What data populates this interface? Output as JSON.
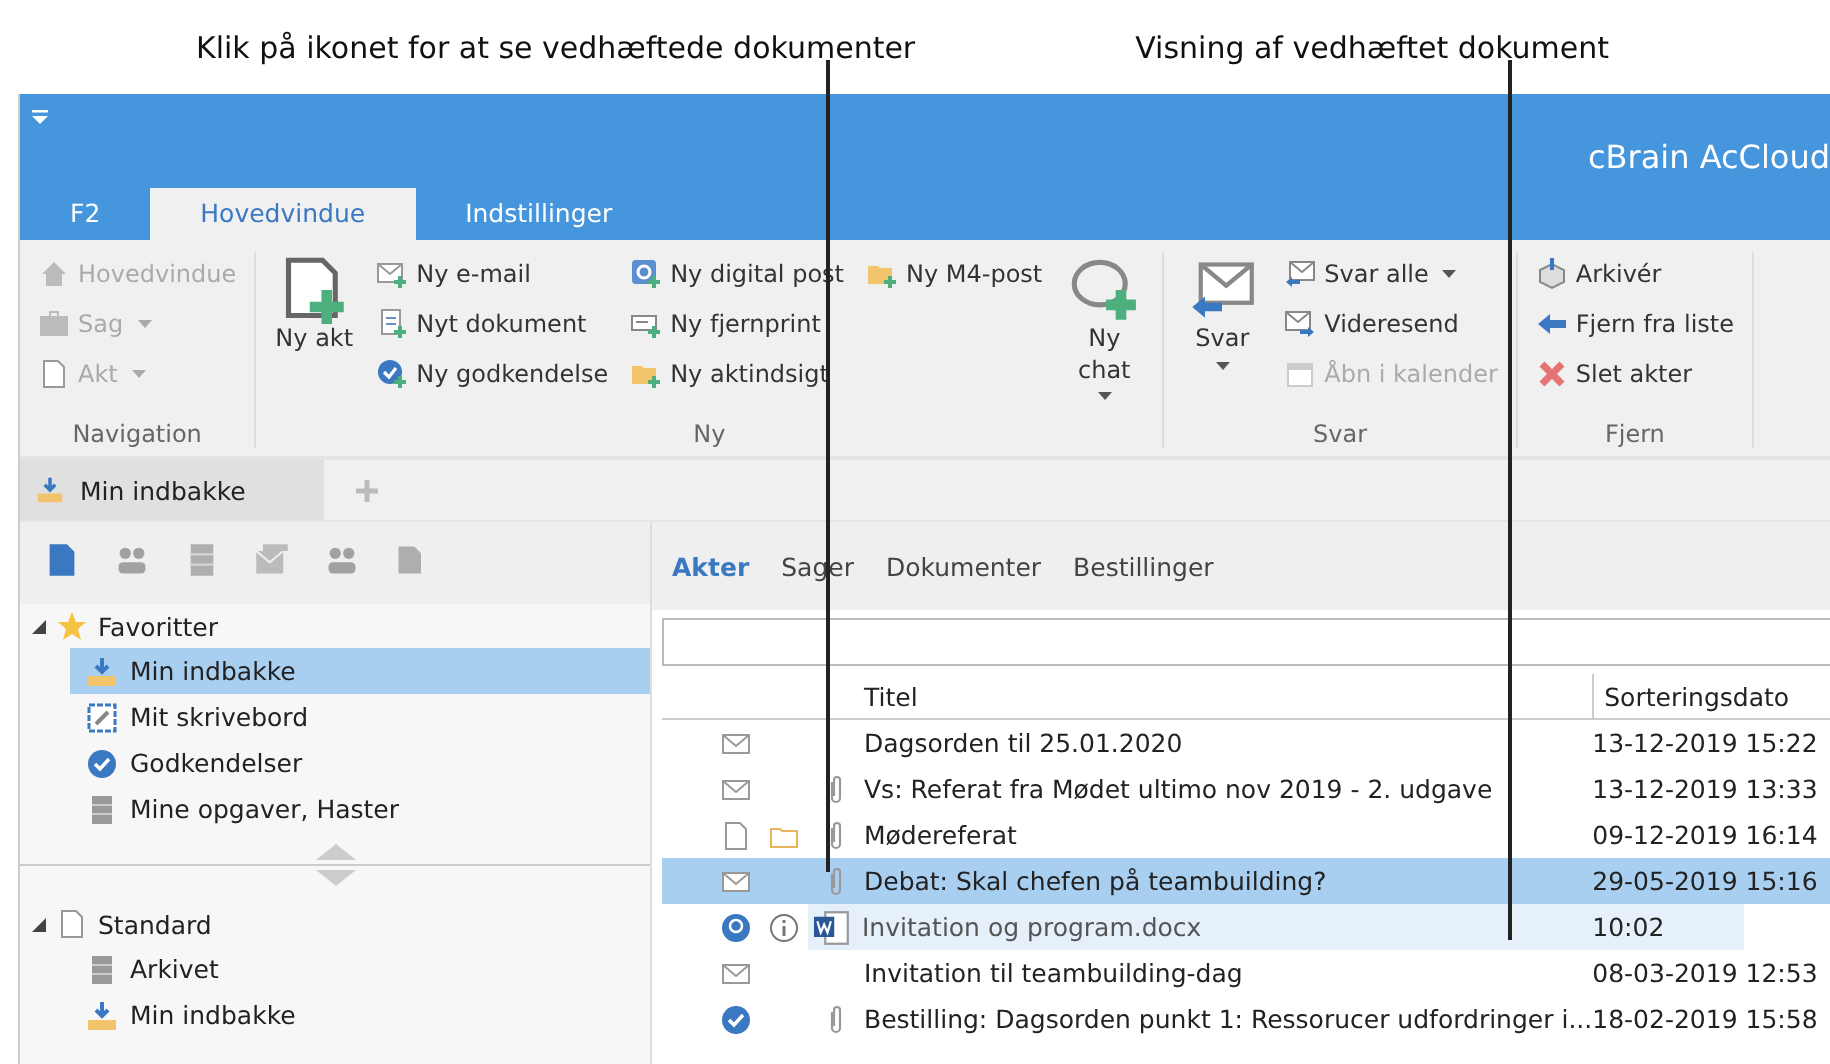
{
  "callouts": [
    {
      "text": "Klik på ikonet for at se vedhæftede dokumenter"
    },
    {
      "text": "Visning af vedhæftet dokument"
    }
  ],
  "window": {
    "title": "cBrain AcCloud"
  },
  "ribbon_tabs": [
    {
      "label": "F2",
      "selected": false
    },
    {
      "label": "Hovedvindue",
      "selected": true
    },
    {
      "label": "Indstillinger",
      "selected": false
    }
  ],
  "ribbon_groups": [
    {
      "label": "Navigation",
      "columns": [
        {
          "kind": "stack",
          "items": [
            {
              "kind": "house",
              "label": "Hovedvindue",
              "disabled": true,
              "dropdown": false
            },
            {
              "kind": "briefcase",
              "label": "Sag",
              "disabled": true,
              "dropdown": true
            },
            {
              "kind": "page",
              "label": "Akt",
              "disabled": true,
              "dropdown": true
            }
          ]
        }
      ]
    },
    {
      "label": "Ny",
      "columns": [
        {
          "kind": "large",
          "items": [
            {
              "kind": "page-plus",
              "label": "Ny akt",
              "disabled": false,
              "dropdown": false
            }
          ]
        },
        {
          "kind": "stack",
          "items": [
            {
              "kind": "envelope-plus",
              "label": "Ny e-mail",
              "disabled": false,
              "dropdown": false
            },
            {
              "kind": "document-plus",
              "label": "Nyt dokument",
              "disabled": false,
              "dropdown": false
            },
            {
              "kind": "check-plus",
              "label": "Ny godkendelse",
              "disabled": false,
              "dropdown": false
            }
          ]
        },
        {
          "kind": "stack",
          "items": [
            {
              "kind": "target-plus",
              "label": "Ny digital post",
              "disabled": false,
              "dropdown": false
            },
            {
              "kind": "printer-plus",
              "label": "Ny fjernprint",
              "disabled": false,
              "dropdown": false
            },
            {
              "kind": "folder-plus",
              "label": "Ny aktindsigt",
              "disabled": false,
              "dropdown": false
            }
          ]
        },
        {
          "kind": "stack",
          "items": [
            {
              "kind": "folder-plus",
              "label": "Ny M4-post",
              "disabled": false,
              "dropdown": false
            }
          ]
        },
        {
          "kind": "large",
          "items": [
            {
              "kind": "chat-plus",
              "label": "Ny chat",
              "disabled": false,
              "dropdown": true
            }
          ]
        }
      ]
    },
    {
      "label": "Svar",
      "columns": [
        {
          "kind": "large",
          "items": [
            {
              "kind": "envelope-reply",
              "label": "Svar",
              "disabled": false,
              "dropdown": true
            }
          ]
        },
        {
          "kind": "stack",
          "items": [
            {
              "kind": "envelope-reply",
              "label": "Svar alle",
              "disabled": false,
              "dropdown": true
            },
            {
              "kind": "envelope-forward",
              "label": "Videresend",
              "disabled": false,
              "dropdown": false
            },
            {
              "kind": "calendar",
              "label": "Åbn i kalender",
              "disabled": true,
              "dropdown": false
            }
          ]
        }
      ]
    },
    {
      "label": "Fjern",
      "columns": [
        {
          "kind": "stack",
          "items": [
            {
              "kind": "box",
              "label": "Arkivér",
              "disabled": false,
              "dropdown": false
            },
            {
              "kind": "arrow-left",
              "label": "Fjern fra liste",
              "disabled": false,
              "dropdown": false
            },
            {
              "kind": "cross",
              "label": "Slet akter",
              "disabled": false,
              "dropdown": false
            }
          ]
        }
      ]
    }
  ],
  "doc_tabs": [
    {
      "label": "Min indbakke",
      "selected": true
    }
  ],
  "sidebar": {
    "tools": [
      {
        "kind": "page",
        "selected": true
      },
      {
        "kind": "people",
        "selected": false
      },
      {
        "kind": "cabinet",
        "selected": false
      },
      {
        "kind": "envelopes",
        "selected": false
      },
      {
        "kind": "people",
        "selected": false
      },
      {
        "kind": "folder",
        "selected": false
      }
    ],
    "sections": [
      {
        "label": "Favoritter",
        "kind": "star",
        "expanded": true,
        "children": [
          {
            "label": "Min indbakke",
            "kind": "inbox",
            "selected": true
          },
          {
            "label": "Mit skrivebord",
            "kind": "desk",
            "selected": false
          },
          {
            "label": "Godkendelser",
            "kind": "check",
            "selected": false
          },
          {
            "label": "Mine opgaver, Haster",
            "kind": "cabinet",
            "selected": false
          }
        ]
      },
      {
        "label": "Standard",
        "kind": "page",
        "expanded": true,
        "children": [
          {
            "label": "Arkivet",
            "kind": "cabinet",
            "selected": false
          },
          {
            "label": "Min indbakke",
            "kind": "inbox",
            "selected": false
          }
        ]
      }
    ]
  },
  "list_tabs": [
    {
      "label": "Akter",
      "selected": true
    },
    {
      "label": "Sager",
      "selected": false
    },
    {
      "label": "Dokumenter",
      "selected": false
    },
    {
      "label": "Bestillinger",
      "selected": false
    }
  ],
  "table": {
    "columns": [
      "Titel",
      "Sorteringsdato"
    ],
    "rows": [
      {
        "kind": "item",
        "icons": [
          {
            "kind": "envelope"
          }
        ],
        "attachment": false,
        "title": "Dagsorden til 25.01.2020",
        "date": "13-12-2019 15:22",
        "selected": false
      },
      {
        "kind": "item",
        "icons": [
          {
            "kind": "envelope"
          }
        ],
        "attachment": true,
        "title": "Vs: Referat fra Mødet ultimo nov 2019 - 2. udgave",
        "date": "13-12-2019 13:33",
        "selected": false
      },
      {
        "kind": "item",
        "icons": [
          {
            "kind": "page"
          },
          {
            "kind": "folder"
          }
        ],
        "attachment": true,
        "title": "Mødereferat",
        "date": "09-12-2019 16:14",
        "selected": false
      },
      {
        "kind": "item",
        "icons": [
          {
            "kind": "envelope"
          }
        ],
        "attachment": true,
        "title": "Debat: Skal chefen på teambuilding?",
        "date": "29-05-2019 15:16",
        "selected": true
      },
      {
        "kind": "preview",
        "icons": [
          {
            "kind": "badge"
          },
          {
            "kind": "info"
          }
        ],
        "title": "Invitation og program.docx",
        "date": "10:02",
        "selected": false
      },
      {
        "kind": "item",
        "icons": [
          {
            "kind": "envelope"
          }
        ],
        "attachment": false,
        "title": "Invitation til teambuilding-dag",
        "date": "08-03-2019 12:53",
        "selected": false
      },
      {
        "kind": "item",
        "icons": [
          {
            "kind": "check"
          }
        ],
        "attachment": true,
        "title": "Bestilling: Dagsorden punkt 1: Ressorucer udfordringer i...",
        "date": "18-02-2019 15:58",
        "selected": false
      }
    ]
  }
}
